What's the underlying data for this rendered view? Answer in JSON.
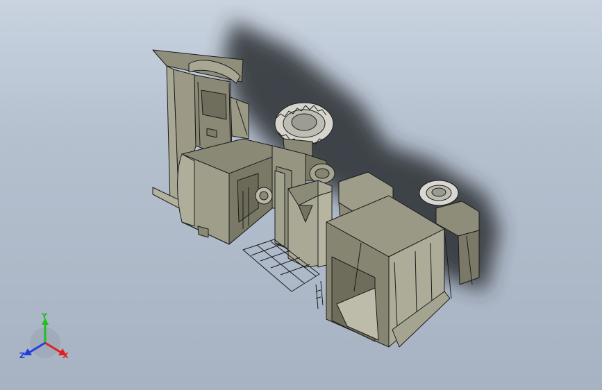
{
  "viewport": {
    "background_top": "#c9d3e0",
    "background_bottom": "#a7b2c2"
  },
  "model": {
    "body_color": "#9c9a86",
    "edge_color": "#1a1a1a",
    "shadow_color": "#2a2d33"
  },
  "triad": {
    "x_label": "X",
    "y_label": "Y",
    "z_label": "Z",
    "x_color": "#e02020",
    "y_color": "#20c020",
    "z_color": "#2040e0"
  }
}
